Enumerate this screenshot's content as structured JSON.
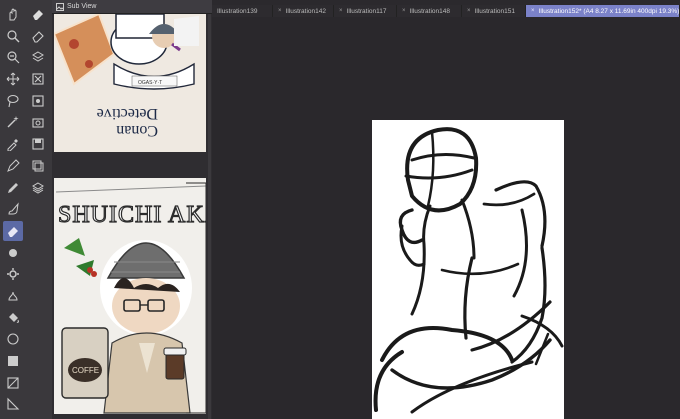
{
  "app": {
    "subview_title": "Sub View"
  },
  "tabs": [
    {
      "label": "Illustration139",
      "active": false
    },
    {
      "label": "Illustration142",
      "active": false
    },
    {
      "label": "Illustration117",
      "active": false
    },
    {
      "label": "Illustration148",
      "active": false
    },
    {
      "label": "Illustration151",
      "active": false
    },
    {
      "label": "Illustration152* (A4 8.27 x 11.69in 400dpi 19.3%)",
      "active": true
    }
  ],
  "tools_left": [
    "hand-icon",
    "zoom-icon",
    "zoom-icon",
    "move-icon",
    "lasso-icon",
    "magic-wand-icon",
    "eyedropper-icon",
    "pen-icon",
    "pencil-icon",
    "brush-icon",
    "airbrush-icon",
    "blend-icon",
    "eraser-icon",
    "pattern-icon",
    "gear-brush-icon",
    "gradient-fill-icon",
    "fill-icon",
    "shape-icon",
    "rect-icon",
    "frame-icon",
    "ruler-icon",
    "text-icon",
    "pointer-icon"
  ],
  "tools_right": [
    "eraser-icon",
    "eraser-soft-icon",
    "layer-icon",
    "close-box-icon",
    "clear-icon",
    "camera-icon",
    "save-icon",
    "copy-icon",
    "layers-icon"
  ],
  "reference_images": [
    {
      "name": "ref-image-detective-conan"
    },
    {
      "name": "ref-image-shuichi-akai"
    }
  ],
  "colors": {
    "accent_tab": "#7b82c9",
    "active_tool": "#5c6aa5",
    "toolbar_bg": "#3a383c",
    "canvas_bg": "#2a282c"
  }
}
